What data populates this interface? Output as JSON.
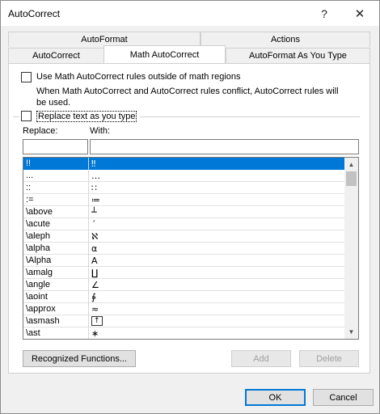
{
  "window": {
    "title": "AutoCorrect",
    "help_glyph": "?",
    "close_glyph": "✕"
  },
  "tabs": {
    "row1": [
      {
        "label": "AutoFormat"
      },
      {
        "label": "Actions"
      }
    ],
    "row2": [
      {
        "label": "AutoCorrect"
      },
      {
        "label": "Math AutoCorrect",
        "active": true
      },
      {
        "label": "AutoFormat As You Type"
      }
    ]
  },
  "options": {
    "use_outside_label": "Use Math AutoCorrect rules outside of math regions",
    "use_outside_checked": false,
    "conflict_note_line1": "When Math AutoCorrect and AutoCorrect rules conflict, AutoCorrect rules will",
    "conflict_note_line2": "be used.",
    "replace_as_you_type_label": "Replace text as you type",
    "replace_as_you_type_checked": false
  },
  "fields": {
    "replace_label": "Replace:",
    "with_label": "With:",
    "replace_value": "",
    "with_value": ""
  },
  "list": {
    "rows": [
      {
        "replace": "!!",
        "with": "‼",
        "selected": true
      },
      {
        "replace": "...",
        "with": "…"
      },
      {
        "replace": "::",
        "with": "∷"
      },
      {
        "replace": ":=",
        "with": "≔"
      },
      {
        "replace": "\\above",
        "with": "┴"
      },
      {
        "replace": "\\acute",
        "with": "´"
      },
      {
        "replace": "\\aleph",
        "with": "ℵ"
      },
      {
        "replace": "\\alpha",
        "with": "α"
      },
      {
        "replace": "\\Alpha",
        "with": "A"
      },
      {
        "replace": "\\amalg",
        "with": "∐"
      },
      {
        "replace": "\\angle",
        "with": "∠"
      },
      {
        "replace": "\\aoint",
        "with": "∳"
      },
      {
        "replace": "\\approx",
        "with": "≈"
      },
      {
        "replace": "\\asmash",
        "with": "↑"
      },
      {
        "replace": "\\ast",
        "with": "∗"
      }
    ]
  },
  "buttons": {
    "recognized_functions": "Recognized Functions...",
    "add": "Add",
    "delete": "Delete",
    "ok": "OK",
    "cancel": "Cancel"
  }
}
